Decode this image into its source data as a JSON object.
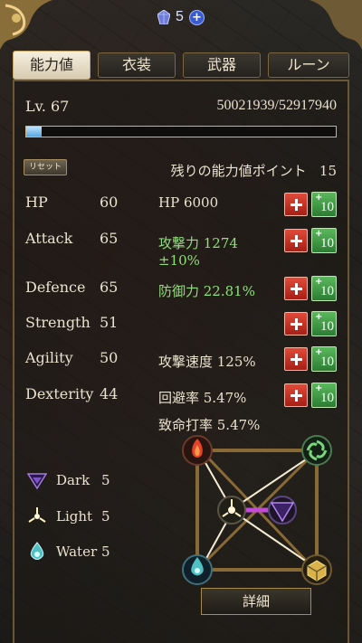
{
  "currency": {
    "count": "5",
    "icon": "crystal-gem-icon",
    "add_icon": "plus-circle-icon"
  },
  "tabs": [
    {
      "label": "能力値",
      "active": true
    },
    {
      "label": "衣装",
      "active": false
    },
    {
      "label": "武器",
      "active": false
    },
    {
      "label": "ルーン",
      "active": false
    }
  ],
  "level": {
    "label": "Lv. 67",
    "exp_text": "50021939/52917940",
    "exp_progress": 0.05
  },
  "reset_label": "リセット",
  "remaining": {
    "label": "残りの能力値ポイント",
    "value": "15"
  },
  "stats": [
    {
      "name": "HP",
      "value": "60"
    },
    {
      "name": "Attack",
      "value": "65"
    },
    {
      "name": "Defence",
      "value": "65"
    },
    {
      "name": "Strength",
      "value": "51"
    },
    {
      "name": "Agility",
      "value": "50"
    },
    {
      "name": "Dexterity",
      "value": "44"
    }
  ],
  "derived": {
    "hp": "HP 6000",
    "attack_power": "攻撃力 1274",
    "attack_range": "±10%",
    "defense_power": "防御力 22.81%",
    "attack_speed": "攻撃速度 125%",
    "evasion": "回避率 5.47%",
    "crit": "致命打率 5.47%"
  },
  "buttons": {
    "plus_ten_plus": "+",
    "plus_ten_num": "10"
  },
  "elements": [
    {
      "name": "Dark",
      "count": "5",
      "icon": "dark-triangle-icon"
    },
    {
      "name": "Light",
      "count": "5",
      "icon": "light-burst-icon"
    },
    {
      "name": "Water",
      "count": "5",
      "icon": "water-drop-icon"
    }
  ],
  "detail_label": "詳細",
  "colors": {
    "accent_gold": "#a78a52",
    "plus_red": "#c8352a",
    "plus_green": "#3f9a44",
    "derived_green": "#8fe07a",
    "exp_blue": "#7dc3f0"
  }
}
